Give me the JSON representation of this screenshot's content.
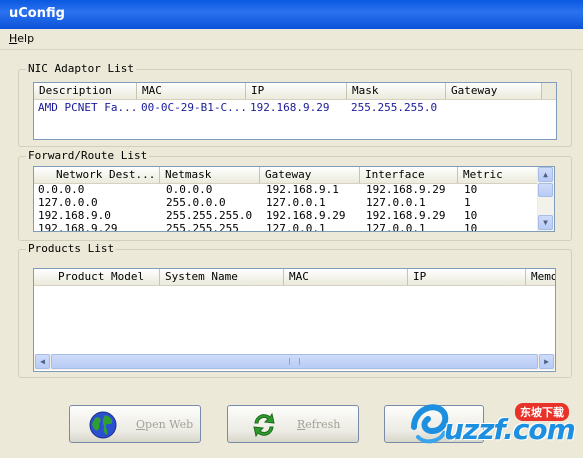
{
  "window": {
    "title": "uConfig"
  },
  "menu": {
    "help": "Help"
  },
  "nic": {
    "title": "NIC Adaptor List",
    "columns": [
      "Description",
      "MAC",
      "IP",
      "Mask",
      "Gateway"
    ],
    "rows": [
      [
        "AMD PCNET Fa...",
        "00-0C-29-B1-C...",
        "192.168.9.29",
        "255.255.255.0",
        ""
      ]
    ]
  },
  "route": {
    "title": "Forward/Route List",
    "columns": [
      "Network Dest...",
      "Netmask",
      "Gateway",
      "Interface",
      "Metric"
    ],
    "rows": [
      [
        "0.0.0.0",
        "0.0.0.0",
        "192.168.9.1",
        "192.168.9.29",
        "10"
      ],
      [
        "127.0.0.0",
        "255.0.0.0",
        "127.0.0.1",
        "127.0.0.1",
        "1"
      ],
      [
        "192.168.9.0",
        "255.255.255.0",
        "192.168.9.29",
        "192.168.9.29",
        "10"
      ],
      [
        "192.168.9.29",
        "255.255.255",
        "127.0.0.1",
        "127.0.0.1",
        "10"
      ]
    ]
  },
  "products": {
    "title": "Products List",
    "columns": [
      "Product Model",
      "System Name",
      "MAC",
      "IP",
      "Memo"
    ],
    "rows": []
  },
  "buttons": {
    "open_web": "Open Web",
    "refresh": "Refresh"
  },
  "watermark": {
    "text": "uzzf.com",
    "badge": "东坡下载"
  },
  "colors": {
    "title_bar": "#0a58e0",
    "face": "#ece9d8",
    "nic_row_text": "#1a1a9a"
  }
}
